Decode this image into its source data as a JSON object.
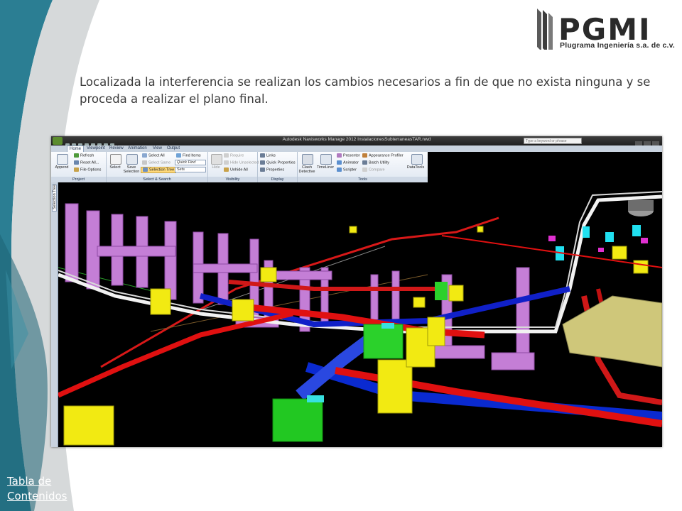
{
  "slide": {
    "caption": "Localizada la interferencia se realizan los cambios necesarios a fin de que no exista ninguna y se proceda a realizar el plano final.",
    "toc_link_line1": "Tabla de",
    "toc_link_line2": "Contenidos",
    "colors": {
      "teal": "#2b7e93",
      "teal_dark": "#1d6275",
      "swoosh_grey": "#d6d9da",
      "text": "#3a3a3a"
    }
  },
  "logo": {
    "wordmark": "PGMI",
    "subtitle": "Plugrama Ingeniería s.a. de c.v."
  },
  "app": {
    "title": "Autodesk Navisworks Manage 2012    InstalacionesSubterraneasTAR.nwd",
    "help_placeholder": "Type a keyword or phrase",
    "tabs": [
      "Home",
      "Viewpoint",
      "Review",
      "Animation",
      "View",
      "Output"
    ],
    "active_tab": "Home",
    "ribbon": {
      "project": {
        "label": "Project",
        "append": "Append",
        "refresh": "Refresh",
        "reset_all": "Reset All...",
        "file_options": "File Options"
      },
      "select_search": {
        "label": "Select & Search",
        "select": "Select",
        "save_selection_1": "Save",
        "save_selection_2": "Selection",
        "select_all": "Select All",
        "select_same": "Select Same",
        "selection_tree": "Selection Tree",
        "find_items": "Find Items",
        "quick_find": "Quick Find",
        "sets": "Sets"
      },
      "visibility": {
        "label": "Visibility",
        "hide": "Hide",
        "require": "Require",
        "hide_unselected": "Hide Unselected",
        "unhide_all": "Unhide All"
      },
      "display": {
        "label": "Display",
        "links": "Links",
        "quick_properties": "Quick Properties",
        "properties": "Properties"
      },
      "tools": {
        "label": "Tools",
        "clash_1": "Clash",
        "clash_2": "Detective",
        "timeliner": "TimeLiner",
        "presenter": "Presenter",
        "animator": "Animator",
        "scripter": "Scripter",
        "appearance_profiler": "Appearance Profiler",
        "batch_utility": "Batch Utility",
        "compare": "Compare",
        "datatools": "DataTools"
      }
    },
    "sidebar_tab": "Selection Tree",
    "icons": [
      "app-menu-icon",
      "help-icon",
      "close-icon",
      "append-icon",
      "refresh-icon",
      "select-icon",
      "save-selection-icon",
      "find-items-icon",
      "hide-icon",
      "links-icon",
      "clash-detective-icon",
      "timeliner-icon",
      "datatools-icon"
    ]
  }
}
